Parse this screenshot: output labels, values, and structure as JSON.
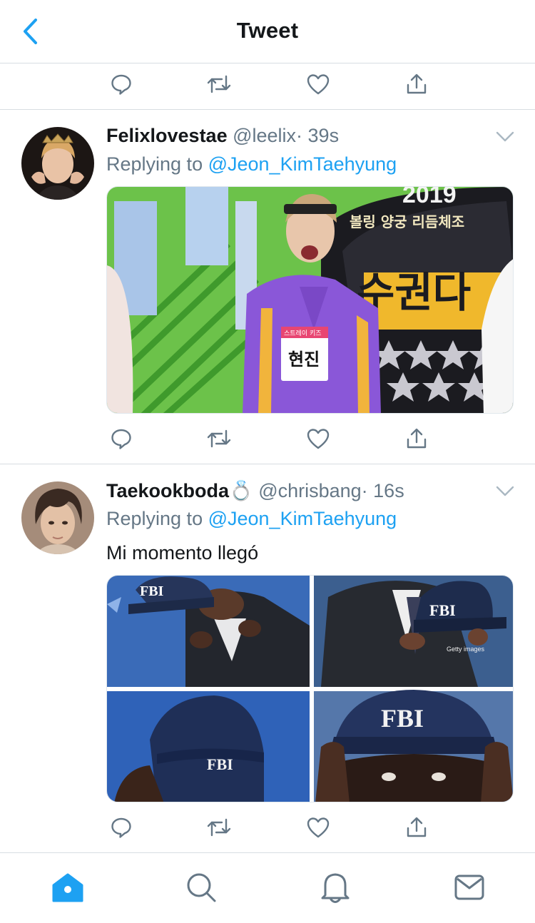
{
  "header": {
    "title": "Tweet"
  },
  "tweets": [
    {
      "author_name": "Felixlovestae",
      "handle": "@leelix",
      "time": "· 39s",
      "replying_prefix": "Replying to ",
      "replying_to": "@Jeon_KimTaehyung",
      "text": "",
      "media_text": {
        "year": "2019",
        "banner": "볼링 양궁 리듬체조",
        "title_chars": "수권다",
        "name_tag_top": "스트레이 키즈",
        "name_tag": "현진"
      }
    },
    {
      "author_name": "Taekookboda",
      "emoji": "💍",
      "handle": "@chrisbang",
      "time": "· 16s",
      "replying_prefix": "Replying to ",
      "replying_to": "@Jeon_KimTaehyung",
      "text": "Mi momento llegó",
      "media_text": {
        "cap1": "FBI",
        "cap2": "FBI",
        "cap3": "FBI",
        "cap4": "FBI",
        "watermark": "Getty images"
      }
    }
  ],
  "icons": {
    "back": "chevron-left-icon",
    "reply": "reply-icon",
    "retweet": "retweet-icon",
    "like": "heart-icon",
    "share": "share-icon",
    "caret": "chevron-down-icon",
    "home": "home-icon",
    "search": "search-icon",
    "notifications": "bell-icon",
    "messages": "mail-icon"
  },
  "colors": {
    "accent": "#1da1f2",
    "secondary_text": "#657786",
    "icon_gray": "#657786",
    "divider": "#d7dde2"
  }
}
